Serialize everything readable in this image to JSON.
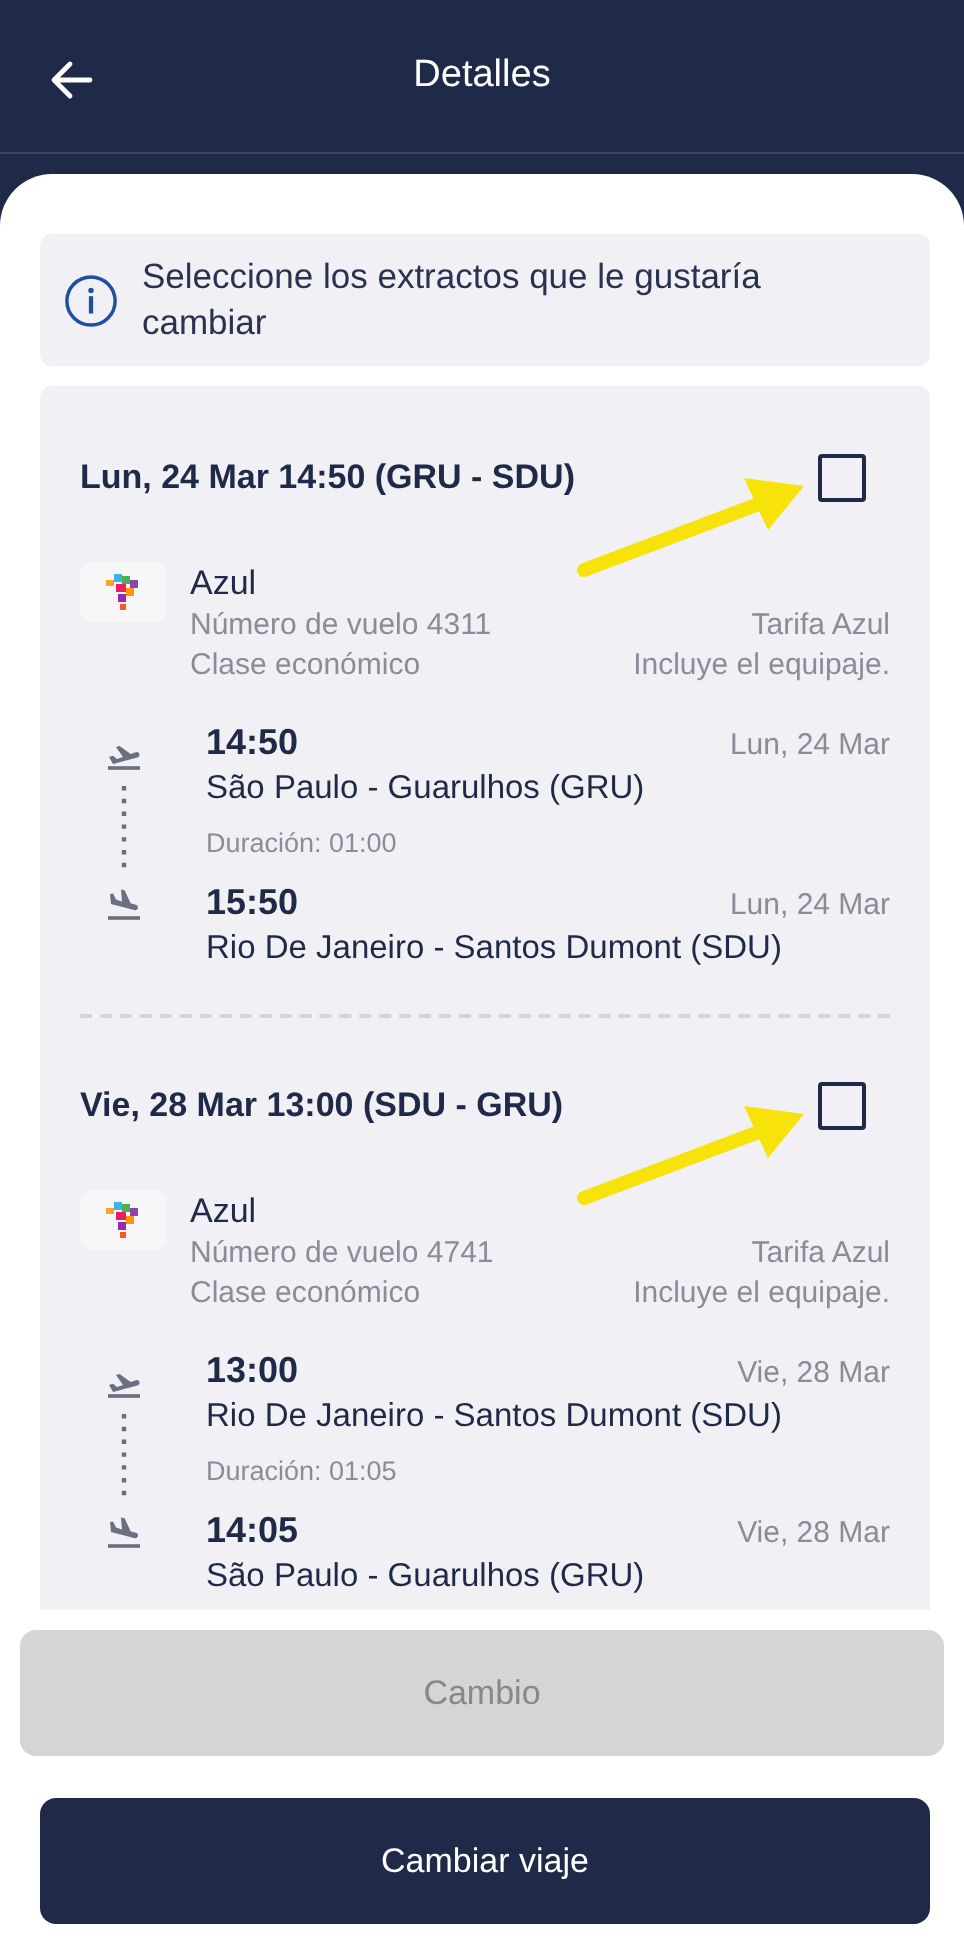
{
  "header": {
    "title": "Detalles"
  },
  "info": {
    "text": "Seleccione los extractos que le gustaría cambiar"
  },
  "segments": [
    {
      "title": "Lun, 24 Mar 14:50 (GRU - SDU)",
      "checked": false,
      "airline": "Azul",
      "flight_number": "Número de vuelo 4311",
      "fare": "Tarifa Azul",
      "cabin": "Clase económico",
      "baggage": "Incluye el equipaje.",
      "departure": {
        "time": "14:50",
        "date": "Lun, 24 Mar",
        "airport": "São Paulo - Guarulhos (GRU)"
      },
      "duration": "Duración: 01:00",
      "arrival": {
        "time": "15:50",
        "date": "Lun, 24 Mar",
        "airport": "Rio De Janeiro - Santos Dumont (SDU)"
      }
    },
    {
      "title": "Vie, 28 Mar 13:00 (SDU - GRU)",
      "checked": false,
      "airline": "Azul",
      "flight_number": "Número de vuelo 4741",
      "fare": "Tarifa Azul",
      "cabin": "Clase económico",
      "baggage": "Incluye el equipaje.",
      "departure": {
        "time": "13:00",
        "date": "Vie, 28 Mar",
        "airport": "Rio De Janeiro - Santos Dumont (SDU)"
      },
      "duration": "Duración: 01:05",
      "arrival": {
        "time": "14:05",
        "date": "Vie, 28 Mar",
        "airport": "São Paulo - Guarulhos (GRU)"
      }
    }
  ],
  "buttons": [
    {
      "label": "Cambio",
      "disabled": true
    },
    {
      "label": "Cambiar viaje",
      "disabled": false
    }
  ]
}
